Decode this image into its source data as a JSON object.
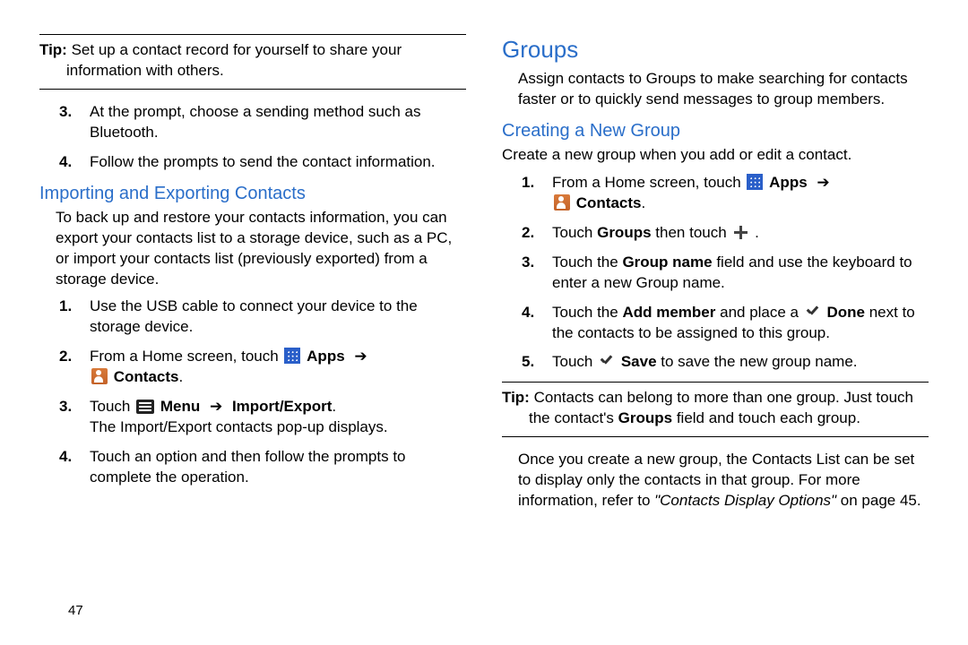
{
  "left": {
    "tip": {
      "label": "Tip:",
      "text": "Set up a contact record for yourself to share your information with others."
    },
    "step3": {
      "num": "3.",
      "text": "At the prompt, choose a sending method such as Bluetooth."
    },
    "step4": {
      "num": "4.",
      "text": "Follow the prompts to send the contact information."
    },
    "h2": "Importing and Exporting Contacts",
    "intro": "To back up and restore your contacts information, you can export your contacts list to a storage device, such as a PC, or import your contacts list (previously exported) from a storage device.",
    "s1": {
      "num": "1.",
      "text": "Use the USB cable to connect your device to the storage device."
    },
    "s2": {
      "num": "2.",
      "pre": "From a Home screen, touch ",
      "apps": "Apps",
      "arrow": "➔",
      "contacts": "Contacts",
      "post": "."
    },
    "s3": {
      "num": "3.",
      "pre": "Touch ",
      "menu": "Menu",
      "arrow": "➔",
      "ie": "Import/Export",
      "post": ".",
      "note": "The Import/Export contacts pop-up displays."
    },
    "s4": {
      "num": "4.",
      "text": "Touch an option and then follow the prompts to complete the operation."
    },
    "pagenum": "47"
  },
  "right": {
    "h1": "Groups",
    "intro": "Assign contacts to Groups to make searching for contacts faster or to quickly send messages to group members.",
    "h2": "Creating a New Group",
    "sub": "Create a new group when you add or edit a contact.",
    "s1": {
      "num": "1.",
      "pre": "From a Home screen, touch ",
      "apps": "Apps",
      "arrow": "➔",
      "contacts": "Contacts",
      "post": "."
    },
    "s2": {
      "num": "2.",
      "pre": "Touch ",
      "groups": "Groups",
      "mid": " then touch ",
      "post": "."
    },
    "s3": {
      "num": "3.",
      "pre": "Touch the ",
      "field": "Group name",
      "post": " field and use the keyboard to enter a new Group name."
    },
    "s4": {
      "num": "4.",
      "pre": "Touch the ",
      "add": "Add member",
      "mid": " and place a ",
      "done": "Done",
      "post": " next to the contacts to be assigned to this group."
    },
    "s5": {
      "num": "5.",
      "pre": "Touch ",
      "save": "Save",
      "post": " to save the new group name."
    },
    "tip": {
      "label": "Tip:",
      "text": "Contacts can belong to more than one group. Just touch the contact's ",
      "field": "Groups",
      "post": " field and touch each group."
    },
    "outro": {
      "a": "Once you create a new group, the Contacts List can be set to display only the contacts in that group. For more information, refer to ",
      "b": "\"Contacts Display Options\"",
      "c": " on page 45."
    }
  }
}
